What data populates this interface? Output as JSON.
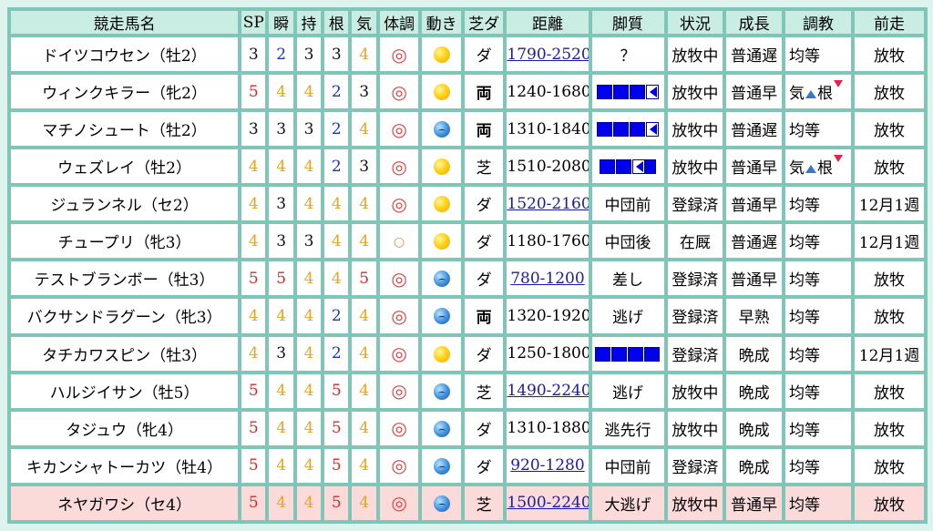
{
  "headers": [
    "競走馬名",
    "SP",
    "瞬",
    "持",
    "根",
    "気",
    "体調",
    "動き",
    "芝ダ",
    "距離",
    "脚質",
    "状況",
    "成長",
    "調教",
    "前走"
  ],
  "colors": {
    "red": "#d42a2a",
    "blue": "#1f2fc8",
    "orange": "#e9a31d",
    "black": "#111111",
    "highlight_row": "#fbdada",
    "border": "#7fc6b8"
  },
  "rows": [
    {
      "name": "ドイツコウセン（牡2）",
      "sp": {
        "v": "3",
        "c": "black"
      },
      "shun": {
        "v": "2",
        "c": "blue"
      },
      "ji": {
        "v": "3",
        "c": "black"
      },
      "kon": {
        "v": "3",
        "c": "black"
      },
      "ki": {
        "v": "4",
        "c": "orange"
      },
      "taicho": "◎",
      "ugoki": "sun",
      "shiba": "ダ",
      "shiba_bold": false,
      "dist": "1790-2520",
      "dist_link": true,
      "kyaku": "？",
      "kyaku_type": "text",
      "jokyo": "放牧中",
      "seicho": "普通遅",
      "chokyo": "均等",
      "chokyo_type": "text",
      "zenso": "放牧"
    },
    {
      "name": "ウィンクキラー（牝2）",
      "sp": {
        "v": "5",
        "c": "red"
      },
      "shun": {
        "v": "4",
        "c": "orange"
      },
      "ji": {
        "v": "4",
        "c": "orange"
      },
      "kon": {
        "v": "2",
        "c": "blue"
      },
      "ki": {
        "v": "3",
        "c": "black"
      },
      "taicho": "◎",
      "ugoki": "sun",
      "shiba": "両",
      "shiba_bold": true,
      "dist": "1240-1680",
      "dist_link": false,
      "kyaku": "bars-arr",
      "kyaku_type": "bars",
      "jokyo": "放牧中",
      "seicho": "普通早",
      "chokyo": "気根",
      "chokyo_type": "kikon",
      "zenso": "放牧"
    },
    {
      "name": "マチノシュート（牡2）",
      "sp": {
        "v": "3",
        "c": "black"
      },
      "shun": {
        "v": "3",
        "c": "black"
      },
      "ji": {
        "v": "3",
        "c": "black"
      },
      "kon": {
        "v": "2",
        "c": "blue"
      },
      "ki": {
        "v": "4",
        "c": "orange"
      },
      "taicho": "◎",
      "ugoki": "rain",
      "shiba": "両",
      "shiba_bold": true,
      "dist": "1310-1840",
      "dist_link": false,
      "kyaku": "bars-arr",
      "kyaku_type": "bars",
      "jokyo": "放牧中",
      "seicho": "普通遅",
      "chokyo": "均等",
      "chokyo_type": "text",
      "zenso": "放牧"
    },
    {
      "name": "ウェズレイ（牡2）",
      "sp": {
        "v": "4",
        "c": "orange"
      },
      "shun": {
        "v": "4",
        "c": "orange"
      },
      "ji": {
        "v": "4",
        "c": "orange"
      },
      "kon": {
        "v": "2",
        "c": "blue"
      },
      "ki": {
        "v": "3",
        "c": "black"
      },
      "taicho": "◎",
      "ugoki": "sun",
      "shiba": "芝",
      "shiba_bold": false,
      "dist": "1510-2080",
      "dist_link": false,
      "kyaku": "bars-arr2",
      "kyaku_type": "bars2",
      "jokyo": "放牧中",
      "seicho": "普通早",
      "chokyo": "気根",
      "chokyo_type": "kikon",
      "zenso": "放牧"
    },
    {
      "name": "ジュランネル（セ2）",
      "sp": {
        "v": "4",
        "c": "orange"
      },
      "shun": {
        "v": "3",
        "c": "black"
      },
      "ji": {
        "v": "4",
        "c": "orange"
      },
      "kon": {
        "v": "4",
        "c": "orange"
      },
      "ki": {
        "v": "4",
        "c": "orange"
      },
      "taicho": "◎",
      "ugoki": "sun",
      "shiba": "ダ",
      "shiba_bold": false,
      "dist": "1520-2160",
      "dist_link": true,
      "kyaku": "中団前",
      "kyaku_type": "text",
      "jokyo": "登録済",
      "seicho": "普通早",
      "chokyo": "均等",
      "chokyo_type": "text",
      "zenso": "12月1週"
    },
    {
      "name": "チュープリ（牝3）",
      "sp": {
        "v": "4",
        "c": "orange"
      },
      "shun": {
        "v": "3",
        "c": "black"
      },
      "ji": {
        "v": "3",
        "c": "black"
      },
      "kon": {
        "v": "4",
        "c": "orange"
      },
      "ki": {
        "v": "4",
        "c": "orange"
      },
      "taicho": "○",
      "ugoki": "sun",
      "shiba": "ダ",
      "shiba_bold": false,
      "dist": "1180-1760",
      "dist_link": false,
      "kyaku": "中団後",
      "kyaku_type": "text",
      "jokyo": "在厩",
      "seicho": "普通遅",
      "chokyo": "均等",
      "chokyo_type": "text",
      "zenso": "12月1週"
    },
    {
      "name": "テストブランボー（牡3）",
      "sp": {
        "v": "5",
        "c": "red"
      },
      "shun": {
        "v": "5",
        "c": "red"
      },
      "ji": {
        "v": "4",
        "c": "orange"
      },
      "kon": {
        "v": "4",
        "c": "orange"
      },
      "ki": {
        "v": "5",
        "c": "red"
      },
      "taicho": "◎",
      "ugoki": "rain",
      "shiba": "ダ",
      "shiba_bold": false,
      "dist": "780-1200",
      "dist_link": true,
      "kyaku": "差し",
      "kyaku_type": "text",
      "jokyo": "登録済",
      "seicho": "普通早",
      "chokyo": "均等",
      "chokyo_type": "text",
      "zenso": "放牧"
    },
    {
      "name": "バクサンドラグーン（牝3）",
      "sp": {
        "v": "4",
        "c": "orange"
      },
      "shun": {
        "v": "4",
        "c": "orange"
      },
      "ji": {
        "v": "4",
        "c": "orange"
      },
      "kon": {
        "v": "2",
        "c": "blue"
      },
      "ki": {
        "v": "4",
        "c": "orange"
      },
      "taicho": "◎",
      "ugoki": "rain",
      "shiba": "両",
      "shiba_bold": true,
      "dist": "1320-1920",
      "dist_link": false,
      "kyaku": "逃げ",
      "kyaku_type": "text",
      "jokyo": "登録済",
      "seicho": "早熟",
      "chokyo": "均等",
      "chokyo_type": "text",
      "zenso": "放牧"
    },
    {
      "name": "タチカワスピン（牡3）",
      "sp": {
        "v": "4",
        "c": "orange"
      },
      "shun": {
        "v": "3",
        "c": "black"
      },
      "ji": {
        "v": "4",
        "c": "orange"
      },
      "kon": {
        "v": "2",
        "c": "blue"
      },
      "ki": {
        "v": "4",
        "c": "orange"
      },
      "taicho": "◎",
      "ugoki": "sun",
      "shiba": "ダ",
      "shiba_bold": false,
      "dist": "1250-1800",
      "dist_link": false,
      "kyaku": "bars-full",
      "kyaku_type": "bars3",
      "jokyo": "登録済",
      "seicho": "晩成",
      "chokyo": "均等",
      "chokyo_type": "text",
      "zenso": "12月1週"
    },
    {
      "name": "ハルジイサン（牡5）",
      "sp": {
        "v": "5",
        "c": "red"
      },
      "shun": {
        "v": "4",
        "c": "orange"
      },
      "ji": {
        "v": "4",
        "c": "orange"
      },
      "kon": {
        "v": "5",
        "c": "red"
      },
      "ki": {
        "v": "4",
        "c": "orange"
      },
      "taicho": "◎",
      "ugoki": "rain",
      "shiba": "芝",
      "shiba_bold": false,
      "dist": "1490-2240",
      "dist_link": true,
      "kyaku": "逃げ",
      "kyaku_type": "text",
      "jokyo": "放牧中",
      "seicho": "晩成",
      "chokyo": "均等",
      "chokyo_type": "text",
      "zenso": "放牧"
    },
    {
      "name": "タジュウ（牝4）",
      "sp": {
        "v": "5",
        "c": "red"
      },
      "shun": {
        "v": "4",
        "c": "orange"
      },
      "ji": {
        "v": "4",
        "c": "orange"
      },
      "kon": {
        "v": "5",
        "c": "red"
      },
      "ki": {
        "v": "4",
        "c": "orange"
      },
      "taicho": "◎",
      "ugoki": "rain",
      "shiba": "ダ",
      "shiba_bold": false,
      "dist": "1310-1880",
      "dist_link": false,
      "kyaku": "逃先行",
      "kyaku_type": "text",
      "jokyo": "放牧中",
      "seicho": "晩成",
      "chokyo": "均等",
      "chokyo_type": "text",
      "zenso": "放牧"
    },
    {
      "name": "キカンシャトーカツ（牡4）",
      "sp": {
        "v": "5",
        "c": "red"
      },
      "shun": {
        "v": "4",
        "c": "orange"
      },
      "ji": {
        "v": "4",
        "c": "orange"
      },
      "kon": {
        "v": "5",
        "c": "red"
      },
      "ki": {
        "v": "4",
        "c": "orange"
      },
      "taicho": "◎",
      "ugoki": "rain",
      "shiba": "ダ",
      "shiba_bold": false,
      "dist": "920-1280",
      "dist_link": true,
      "kyaku": "中団前",
      "kyaku_type": "text",
      "jokyo": "登録済",
      "seicho": "晩成",
      "chokyo": "均等",
      "chokyo_type": "text",
      "zenso": "放牧"
    },
    {
      "name": "ネヤガワシ（セ4）",
      "sp": {
        "v": "5",
        "c": "red"
      },
      "shun": {
        "v": "4",
        "c": "orange"
      },
      "ji": {
        "v": "4",
        "c": "orange"
      },
      "kon": {
        "v": "5",
        "c": "red"
      },
      "ki": {
        "v": "4",
        "c": "orange"
      },
      "taicho": "◎",
      "ugoki": "rain",
      "shiba": "芝",
      "shiba_bold": false,
      "dist": "1500-2240",
      "dist_link": true,
      "kyaku": "大逃げ",
      "kyaku_type": "text",
      "jokyo": "放牧中",
      "seicho": "普通早",
      "chokyo": "均等",
      "chokyo_type": "text",
      "zenso": "放牧",
      "highlight": true
    }
  ]
}
